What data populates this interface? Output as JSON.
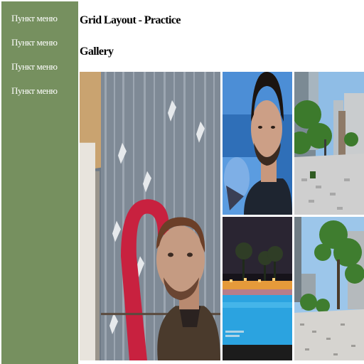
{
  "sidebar": {
    "items": [
      {
        "label": "Пункт меню"
      },
      {
        "label": "Пункт меню"
      },
      {
        "label": "Пункт меню"
      },
      {
        "label": "Пункт меню"
      }
    ]
  },
  "header": {
    "title": "Grid Layout - Practice"
  },
  "gallery": {
    "title": "Gallery"
  },
  "colors": {
    "sidebar_bg": "#76905f",
    "text": "#000000",
    "sidebar_text": "#ffffff"
  }
}
